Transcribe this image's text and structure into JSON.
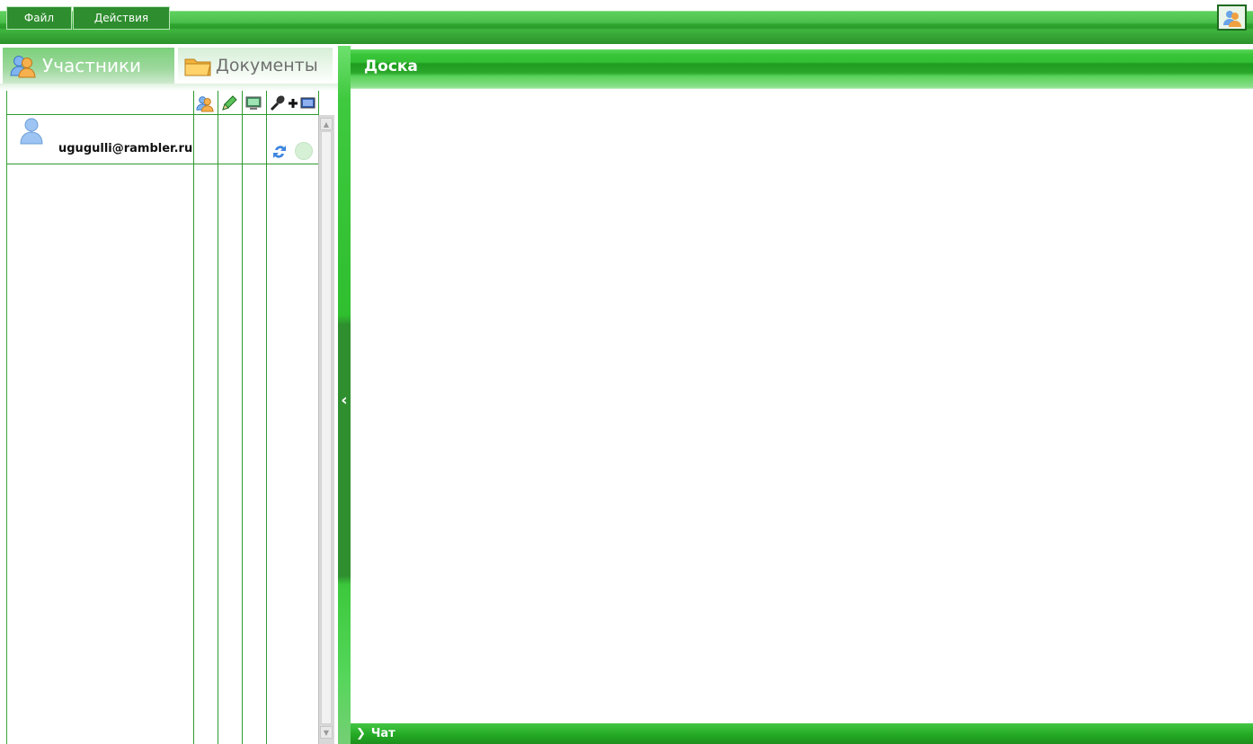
{
  "menu": {
    "file_label": "Файл",
    "actions_label": "Действия",
    "user_icon": "users-icon"
  },
  "tabs": [
    {
      "label": "Участники",
      "icon": "users-icon",
      "active": true
    },
    {
      "label": "Документы",
      "icon": "folder-icon",
      "active": false
    }
  ],
  "participants": {
    "columns": [
      {
        "icon": "users-icon"
      },
      {
        "icon": "pencil-icon"
      },
      {
        "icon": "monitor-icon"
      },
      {
        "icon": "microphone-plus-screen-icon"
      }
    ],
    "rows": [
      {
        "email": "ugugulli@rambler.ru",
        "avatar": "user-icon",
        "sync_icon": "refresh-icon",
        "status": "idle"
      }
    ]
  },
  "board": {
    "title": "Доска"
  },
  "chat": {
    "label": "Чат"
  },
  "colors": {
    "primary_green": "#2ea82e",
    "light_green": "#7bd07b",
    "dark_green": "#1f6a1f"
  }
}
